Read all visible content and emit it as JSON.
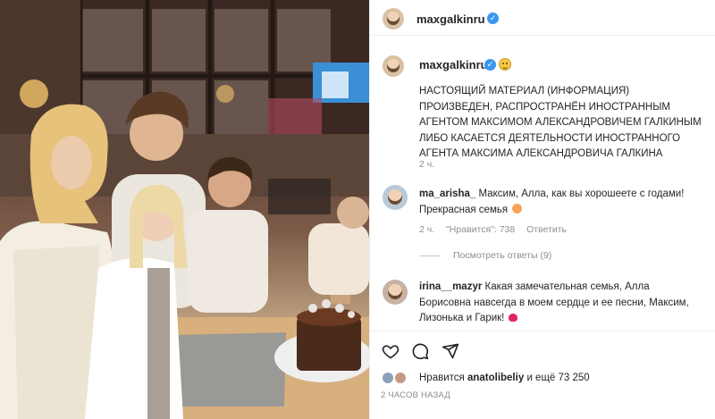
{
  "post": {
    "author": "maxgalkinru",
    "verified_icon": "verified-badge-icon",
    "author_emoji": "smiling-face-icon"
  },
  "caption": {
    "author": "maxgalkinru",
    "text": "НАСТОЯЩИЙ МАТЕРИАЛ (ИНФОРМАЦИЯ) ПРОИЗВЕДЕН, РАСПРОСТРАНЁН ИНОСТРАННЫМ АГЕНТОМ МАКСИМОМ АЛЕКСАНДРОВИЧЕМ ГАЛКИНЫМ ЛИБО КАСАЕТСЯ ДЕЯТЕЛЬНОСТИ ИНОСТРАННОГО АГЕНТА МАКСИМА АЛЕКСАНДРОВИЧА ГАЛКИНА",
    "time": "2 ч."
  },
  "comments": [
    {
      "user": "ma_arisha_",
      "text": "Максим, Алла, как вы хорошеете с годами! Прекрасная семья",
      "emoji": "heart-eyes-icon",
      "time": "2 ч.",
      "likes": "\"Нравится\": 738",
      "reply": "Ответить",
      "view_replies": "Посмотреть ответы (9)"
    },
    {
      "user": "irina__mazyr",
      "text": "Какая замечательная семья, Алла Борисовна навсегда в моем сердце и ее песни, Максим, Лизонька и Гарик!",
      "emoji": "heart-icon"
    }
  ],
  "actions": {
    "like_icon": "heart-outline-icon",
    "comment_icon": "comment-bubble-icon",
    "share_icon": "paper-plane-icon"
  },
  "likes": {
    "prefix": "Нравится",
    "user": "anatolibeliy",
    "suffix": "и ещё 73 250"
  },
  "posted_ago": "2 ЧАСОВ НАЗАД",
  "colors": {
    "verified": "#3897f0",
    "secondary_text": "#8e8e8e",
    "border": "#efefef"
  }
}
